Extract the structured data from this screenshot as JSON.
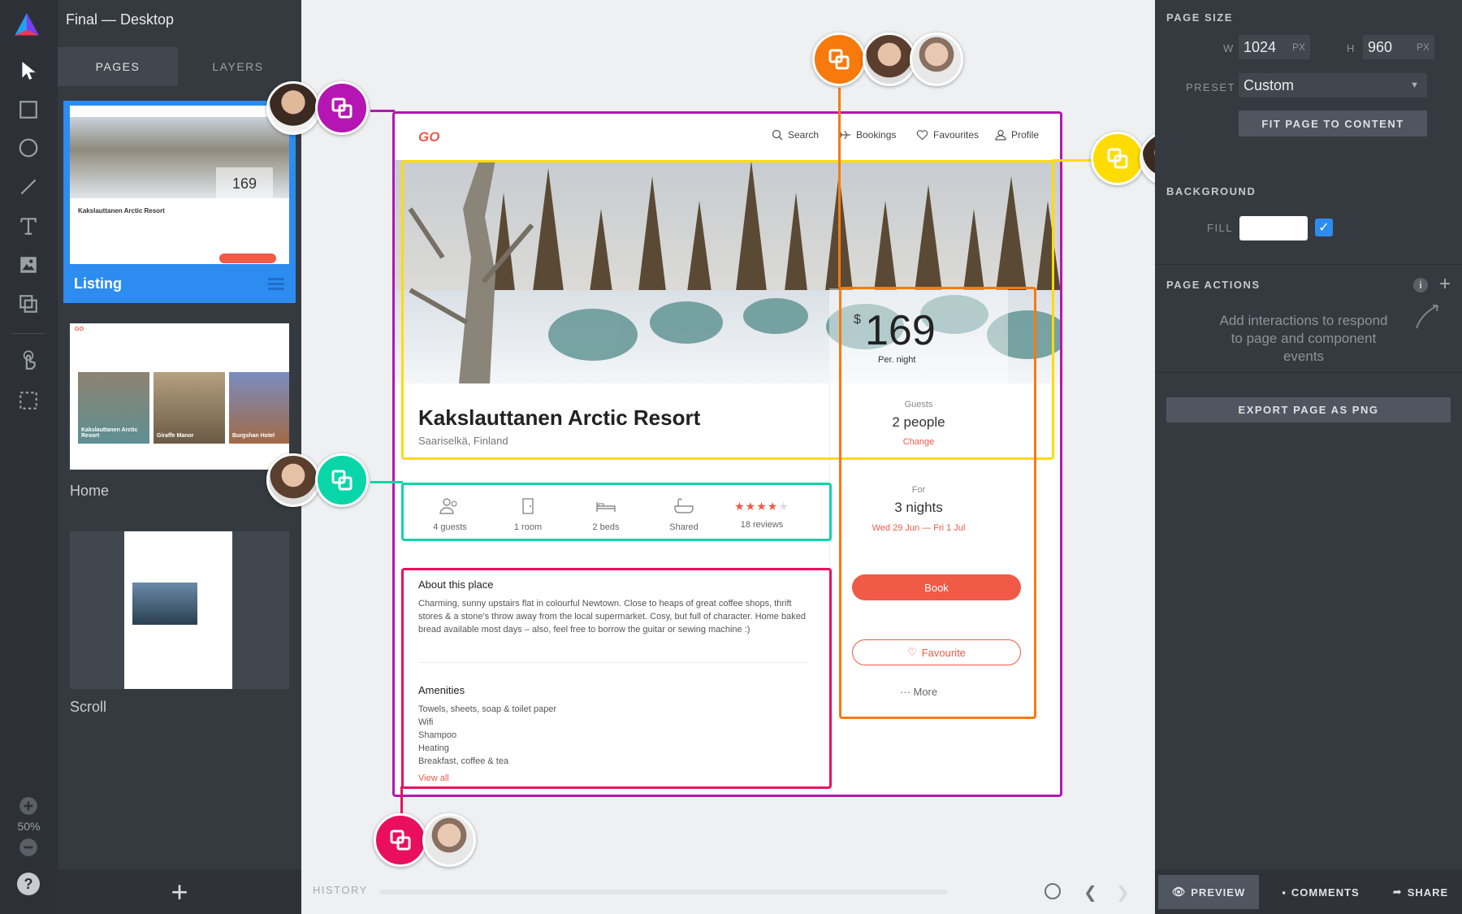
{
  "document": {
    "title": "Final — Desktop"
  },
  "left_panel": {
    "tabs": [
      {
        "label": "PAGES",
        "active": true
      },
      {
        "label": "LAYERS",
        "active": false
      }
    ],
    "pages": [
      {
        "label": "Listing",
        "selected": true
      },
      {
        "label": "Home",
        "selected": false
      },
      {
        "label": "Scroll",
        "selected": false
      }
    ],
    "thumb_listing": {
      "title": "Kakslauttanen Arctic Resort",
      "price": "169"
    },
    "thumb_home": {
      "card1": "Kakslauttanen Arctic Resort",
      "card2": "Giraffe Manor",
      "card3": "Burgshan Hotel"
    },
    "add_page": "+"
  },
  "zoom": {
    "level": "50%"
  },
  "help": "?",
  "artboard": {
    "logo": "GO",
    "nav": [
      "Search",
      "Bookings",
      "Favourites",
      "Profile"
    ],
    "title": "Kakslauttanen Arctic Resort",
    "location": "Saariselkä, Finland",
    "price": {
      "currency": "$",
      "amount": "169",
      "unit": "Per. night"
    },
    "guests": {
      "label": "Guests",
      "value": "2 people",
      "change": "Change"
    },
    "stay": {
      "label": "For",
      "value": "3 nights",
      "dates": "Wed 29 Jun — Fri 1 Jul"
    },
    "book": "Book",
    "favourite": "Favourite",
    "more": "More",
    "amenity_icons": [
      {
        "label": "4 guests",
        "icon": "guests-icon"
      },
      {
        "label": "1 room",
        "icon": "door-icon"
      },
      {
        "label": "2 beds",
        "icon": "bed-icon"
      },
      {
        "label": "Shared",
        "icon": "bath-icon"
      },
      {
        "label": "18 reviews",
        "icon": "stars-icon"
      }
    ],
    "rating": 4,
    "about_title": "About this place",
    "about_text": "Charming, sunny upstairs flat in colourful Newtown. Close to heaps of great coffee shops, thrift stores & a stone's throw away from the local supermarket. Cosy, but full of character. Home baked bread available most days – also, feel free to borrow the guitar or sewing machine :)",
    "amenities_title": "Amenities",
    "amenities": [
      "Towels, sheets, soap & toilet paper",
      "Wifi",
      "Shampoo",
      "Heating",
      "Breakfast, coffee & tea"
    ],
    "view_all": "View all"
  },
  "history": {
    "label": "HISTORY"
  },
  "right_panel": {
    "page_size": {
      "title": "PAGE SIZE",
      "w_label": "W",
      "w": "1024",
      "h_label": "H",
      "h": "960",
      "unit": "PX"
    },
    "preset": {
      "label": "PRESET",
      "value": "Custom"
    },
    "fit_button": "FIT PAGE TO CONTENT",
    "background": {
      "title": "BACKGROUND",
      "fill_label": "FILL",
      "fill_color": "#ffffff",
      "checked": true
    },
    "page_actions": {
      "title": "PAGE ACTIONS",
      "hint": "Add interactions to respond to page and component events"
    },
    "export_button": "EXPORT PAGE AS PNG",
    "bottom": {
      "preview": "PREVIEW",
      "comments": "COMMENTS",
      "share": "SHARE"
    }
  },
  "colors": {
    "accent_blue": "#2d8cf0",
    "brand_red": "#f05a46",
    "purple": "#b516b3",
    "yellow": "#ffdc00",
    "orange": "#f77a0d",
    "teal": "#08d6a8",
    "pink": "#ea0f5e"
  }
}
